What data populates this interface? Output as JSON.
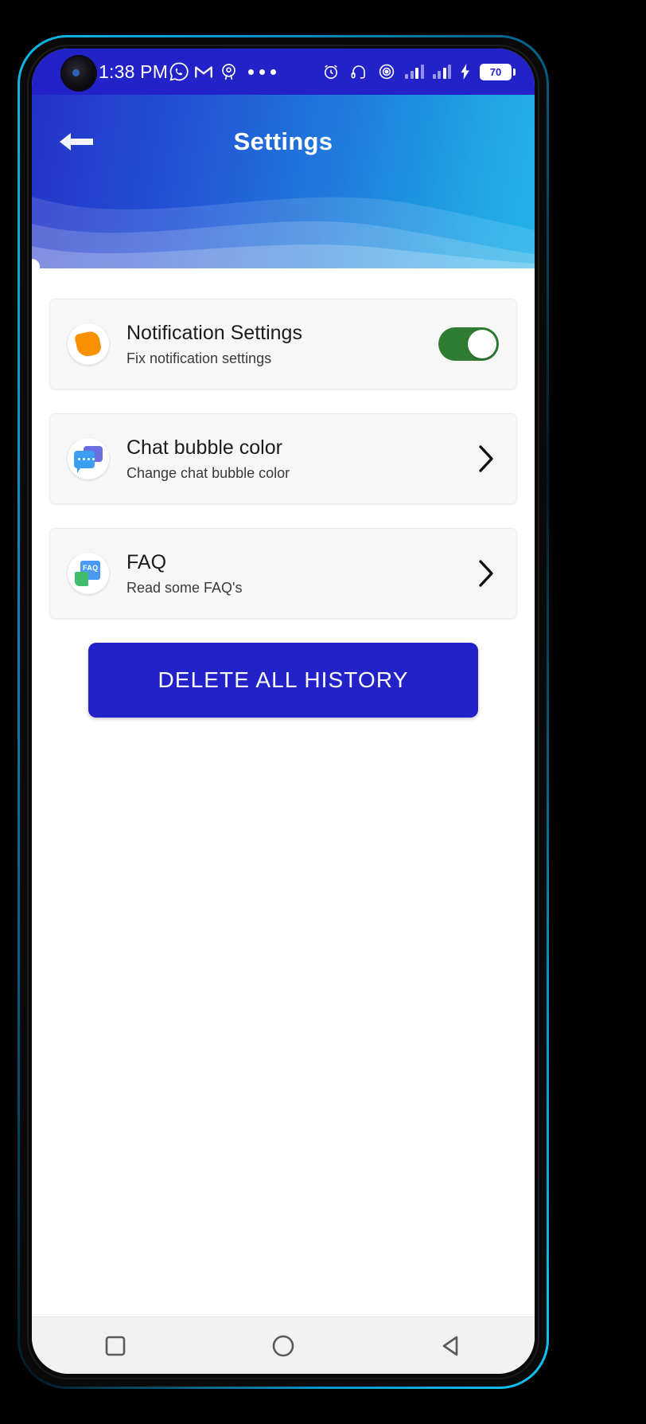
{
  "status_bar": {
    "time": "1:38 PM",
    "left_icons": [
      "whatsapp-icon",
      "gmail-icon",
      "location-pin-icon",
      "overflow-dots-icon"
    ],
    "right_icons": [
      "alarm-clock-icon",
      "headphones-icon",
      "location-tracking-icon",
      "signal-bars-sim1-icon",
      "signal-bars-sim2-icon",
      "charging-bolt-icon"
    ],
    "battery_level": "70",
    "background_color": "#2222c8"
  },
  "app_bar": {
    "title": "Settings",
    "back_icon": "back-arrow-icon",
    "gradient_start": "#2433c8",
    "gradient_end": "#22b2ea"
  },
  "settings": {
    "items": [
      {
        "icon": "notification-bell-icon",
        "title": "Notification Settings",
        "subtitle": "Fix notification settings",
        "control": "toggle",
        "toggle_on": true,
        "toggle_color": "#2e7d32"
      },
      {
        "icon": "chat-bubble-icon",
        "title": "Chat bubble color",
        "subtitle": "Change chat bubble color",
        "control": "chevron",
        "chevron_icon": "chevron-right-icon"
      },
      {
        "icon": "faq-document-icon",
        "title": "FAQ",
        "subtitle": "Read some FAQ's",
        "control": "chevron",
        "chevron_icon": "chevron-right-icon"
      }
    ]
  },
  "actions": {
    "delete_all_history": "DELETE ALL HISTORY",
    "delete_button_color": "#2222c8"
  },
  "nav_bar": {
    "buttons": [
      "recents-square-icon",
      "home-circle-icon",
      "back-triangle-icon"
    ],
    "background_color": "#f2f2f2"
  }
}
